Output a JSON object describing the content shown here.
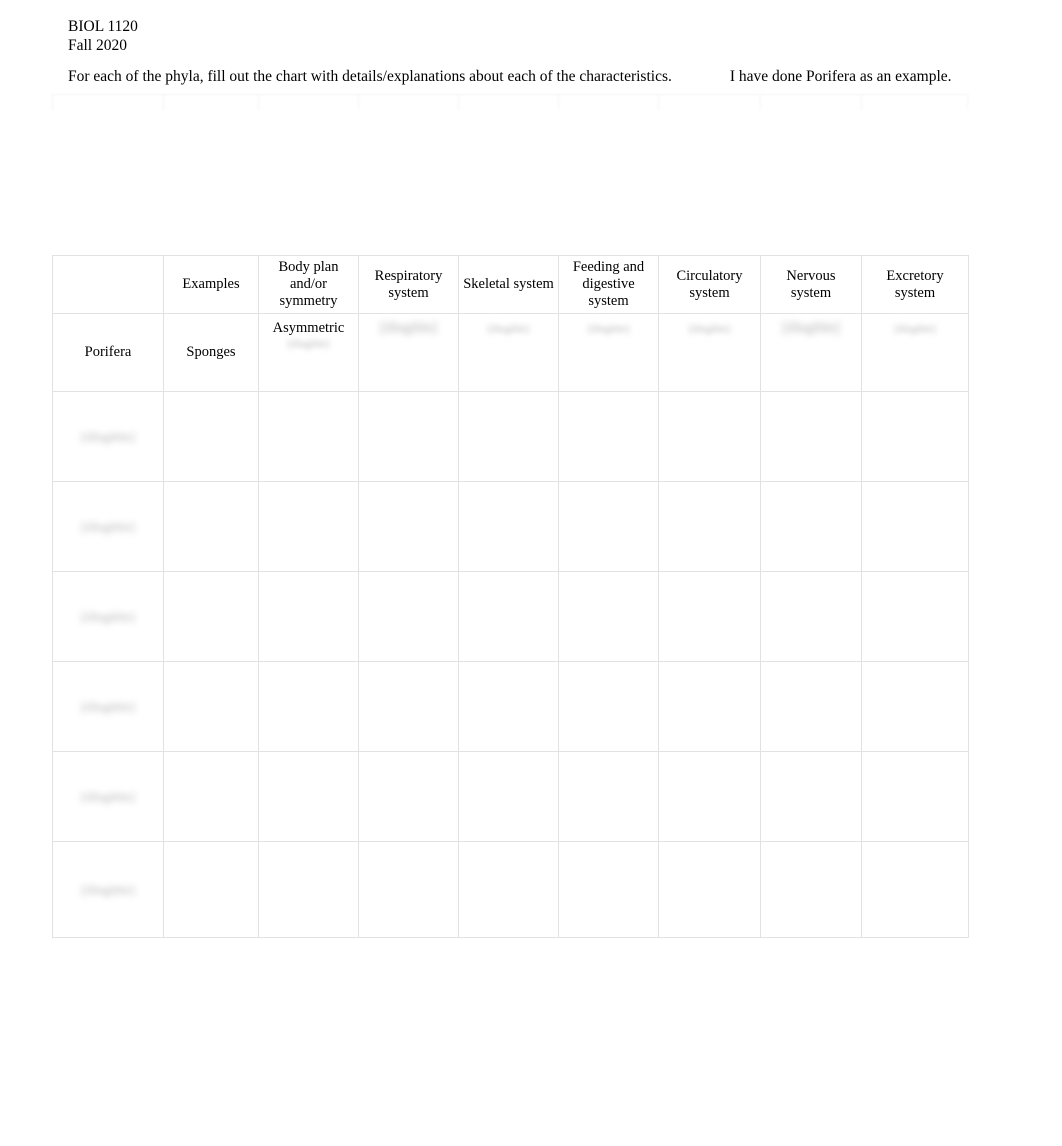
{
  "document": {
    "course": "BIOL 1120",
    "term": "Fall 2020",
    "instruction": "For each of the phyla, fill out the chart with details/explanations about each of the characteristics.",
    "instruction_note": "I have done Porifera as an example."
  },
  "chart_data": {
    "type": "table",
    "title": "Phyla characteristics chart",
    "columns": [
      "",
      "Examples",
      "Body plan and/or symmetry",
      "Respiratory system",
      "Skeletal system",
      "Feeding and digestive system",
      "Circulatory system",
      "Nervous system",
      "Excretory system"
    ],
    "rows": [
      {
        "phylum": "Porifera",
        "phylum_legible": true,
        "cells": [
          {
            "text": "Sponges",
            "legible": true
          },
          {
            "text": "Asymmetric",
            "legible": true,
            "extra": "[illegible]",
            "extra_legible": false
          },
          {
            "text": "[illegible]",
            "legible": false
          },
          {
            "text": "[illegible]",
            "legible": false
          },
          {
            "text": "[illegible]",
            "legible": false
          },
          {
            "text": "[illegible]",
            "legible": false
          },
          {
            "text": "[illegible]",
            "legible": false
          },
          {
            "text": "[illegible]",
            "legible": false
          }
        ]
      },
      {
        "phylum": "[illegible]",
        "phylum_legible": false,
        "cells": [
          {
            "text": "",
            "legible": true
          },
          {
            "text": "",
            "legible": true
          },
          {
            "text": "",
            "legible": true
          },
          {
            "text": "",
            "legible": true
          },
          {
            "text": "",
            "legible": true
          },
          {
            "text": "",
            "legible": true
          },
          {
            "text": "",
            "legible": true
          },
          {
            "text": "",
            "legible": true
          }
        ]
      },
      {
        "phylum": "[illegible]",
        "phylum_legible": false,
        "cells": [
          {
            "text": "",
            "legible": true
          },
          {
            "text": "",
            "legible": true
          },
          {
            "text": "",
            "legible": true
          },
          {
            "text": "",
            "legible": true
          },
          {
            "text": "",
            "legible": true
          },
          {
            "text": "",
            "legible": true
          },
          {
            "text": "",
            "legible": true
          },
          {
            "text": "",
            "legible": true
          }
        ]
      },
      {
        "phylum": "[illegible]",
        "phylum_legible": false,
        "cells": [
          {
            "text": "",
            "legible": true
          },
          {
            "text": "",
            "legible": true
          },
          {
            "text": "",
            "legible": true
          },
          {
            "text": "",
            "legible": true
          },
          {
            "text": "",
            "legible": true
          },
          {
            "text": "",
            "legible": true
          },
          {
            "text": "",
            "legible": true
          },
          {
            "text": "",
            "legible": true
          }
        ]
      },
      {
        "phylum": "[illegible]",
        "phylum_legible": false,
        "cells": [
          {
            "text": "",
            "legible": true
          },
          {
            "text": "",
            "legible": true
          },
          {
            "text": "",
            "legible": true
          },
          {
            "text": "",
            "legible": true
          },
          {
            "text": "",
            "legible": true
          },
          {
            "text": "",
            "legible": true
          },
          {
            "text": "",
            "legible": true
          },
          {
            "text": "",
            "legible": true
          }
        ]
      },
      {
        "phylum": "[illegible]",
        "phylum_legible": false,
        "cells": [
          {
            "text": "",
            "legible": true
          },
          {
            "text": "",
            "legible": true
          },
          {
            "text": "",
            "legible": true
          },
          {
            "text": "",
            "legible": true
          },
          {
            "text": "",
            "legible": true
          },
          {
            "text": "",
            "legible": true
          },
          {
            "text": "",
            "legible": true
          },
          {
            "text": "",
            "legible": true
          }
        ]
      },
      {
        "phylum": "[illegible]",
        "phylum_legible": false,
        "cells": [
          {
            "text": "",
            "legible": true
          },
          {
            "text": "",
            "legible": true
          },
          {
            "text": "",
            "legible": true
          },
          {
            "text": "",
            "legible": true
          },
          {
            "text": "",
            "legible": true
          },
          {
            "text": "",
            "legible": true
          },
          {
            "text": "",
            "legible": true
          },
          {
            "text": "",
            "legible": true
          }
        ]
      }
    ],
    "grid": true,
    "border_color": "#e2e2e2"
  }
}
